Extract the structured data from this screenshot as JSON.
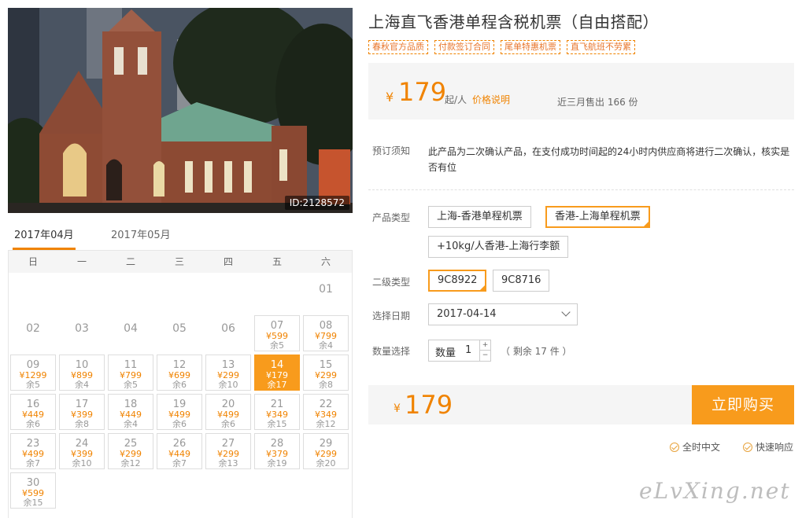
{
  "photo": {
    "id_label": "ID:2128572"
  },
  "calendar": {
    "tabs": [
      {
        "label": "2017年04月",
        "active": true
      },
      {
        "label": "2017年05月",
        "active": false
      }
    ],
    "weekdays": [
      "日",
      "一",
      "二",
      "三",
      "四",
      "五",
      "六"
    ],
    "days": [
      {
        "d": "01",
        "col": 6,
        "row": 0
      },
      {
        "d": "02",
        "col": 0,
        "row": 1
      },
      {
        "d": "03",
        "col": 1,
        "row": 1
      },
      {
        "d": "04",
        "col": 2,
        "row": 1
      },
      {
        "d": "05",
        "col": 3,
        "row": 1
      },
      {
        "d": "06",
        "col": 4,
        "row": 1
      },
      {
        "d": "07",
        "col": 5,
        "row": 1,
        "price": "¥599",
        "remain": "余5"
      },
      {
        "d": "08",
        "col": 6,
        "row": 1,
        "price": "¥799",
        "remain": "余4"
      },
      {
        "d": "09",
        "col": 0,
        "row": 2,
        "price": "¥1299",
        "remain": "余5"
      },
      {
        "d": "10",
        "col": 1,
        "row": 2,
        "price": "¥899",
        "remain": "余4"
      },
      {
        "d": "11",
        "col": 2,
        "row": 2,
        "price": "¥799",
        "remain": "余5"
      },
      {
        "d": "12",
        "col": 3,
        "row": 2,
        "price": "¥699",
        "remain": "余6"
      },
      {
        "d": "13",
        "col": 4,
        "row": 2,
        "price": "¥299",
        "remain": "余10"
      },
      {
        "d": "14",
        "col": 5,
        "row": 2,
        "price": "¥179",
        "remain": "余17",
        "selected": true
      },
      {
        "d": "15",
        "col": 6,
        "row": 2,
        "price": "¥299",
        "remain": "余8"
      },
      {
        "d": "16",
        "col": 0,
        "row": 3,
        "price": "¥449",
        "remain": "余6"
      },
      {
        "d": "17",
        "col": 1,
        "row": 3,
        "price": "¥399",
        "remain": "余8"
      },
      {
        "d": "18",
        "col": 2,
        "row": 3,
        "price": "¥449",
        "remain": "余4"
      },
      {
        "d": "19",
        "col": 3,
        "row": 3,
        "price": "¥499",
        "remain": "余6"
      },
      {
        "d": "20",
        "col": 4,
        "row": 3,
        "price": "¥499",
        "remain": "余6"
      },
      {
        "d": "21",
        "col": 5,
        "row": 3,
        "price": "¥349",
        "remain": "余15"
      },
      {
        "d": "22",
        "col": 6,
        "row": 3,
        "price": "¥349",
        "remain": "余12"
      },
      {
        "d": "23",
        "col": 0,
        "row": 4,
        "price": "¥499",
        "remain": "余7"
      },
      {
        "d": "24",
        "col": 1,
        "row": 4,
        "price": "¥399",
        "remain": "余10"
      },
      {
        "d": "25",
        "col": 2,
        "row": 4,
        "price": "¥299",
        "remain": "余12"
      },
      {
        "d": "26",
        "col": 3,
        "row": 4,
        "price": "¥449",
        "remain": "余7"
      },
      {
        "d": "27",
        "col": 4,
        "row": 4,
        "price": "¥299",
        "remain": "余13"
      },
      {
        "d": "28",
        "col": 5,
        "row": 4,
        "price": "¥379",
        "remain": "余19"
      },
      {
        "d": "29",
        "col": 6,
        "row": 4,
        "price": "¥299",
        "remain": "余20"
      },
      {
        "d": "30",
        "col": 0,
        "row": 5,
        "price": "¥599",
        "remain": "余15"
      }
    ]
  },
  "product": {
    "title": "上海直飞香港单程含税机票（自由搭配）",
    "tags": [
      "春秋官方品质",
      "付款签订合同",
      "尾单特惠机票",
      "直飞航班不劳累"
    ],
    "price": {
      "currency": "¥",
      "amount": "179",
      "unit": "起/人",
      "explain": "价格说明",
      "sold": "近三月售出 166 份"
    },
    "notice": {
      "label": "预订须知",
      "text": "此产品为二次确认产品，在支付成功时间起的24小时内供应商将进行二次确认，核实是否有位"
    },
    "type": {
      "label": "产品类型",
      "options": [
        {
          "text": "上海-香港单程机票",
          "on": false
        },
        {
          "text": "香港-上海单程机票",
          "on": true
        },
        {
          "text": "+10kg/人香港-上海行李额",
          "on": false
        }
      ]
    },
    "subtype": {
      "label": "二级类型",
      "options": [
        {
          "text": "9C8922",
          "on": true
        },
        {
          "text": "9C8716",
          "on": false
        }
      ]
    },
    "date": {
      "label": "选择日期",
      "value": "2017-04-14"
    },
    "quantity": {
      "label": "数量选择",
      "prefix": "数量",
      "value": "1",
      "plus": "+",
      "minus": "−",
      "remain": "（ 剩余 17 件 ）"
    },
    "total": {
      "currency": "¥",
      "amount": "179"
    },
    "buy_label": "立即购买",
    "guarantees": [
      "全时中文",
      "快速响应"
    ]
  },
  "watermark": "eLvXing.net"
}
